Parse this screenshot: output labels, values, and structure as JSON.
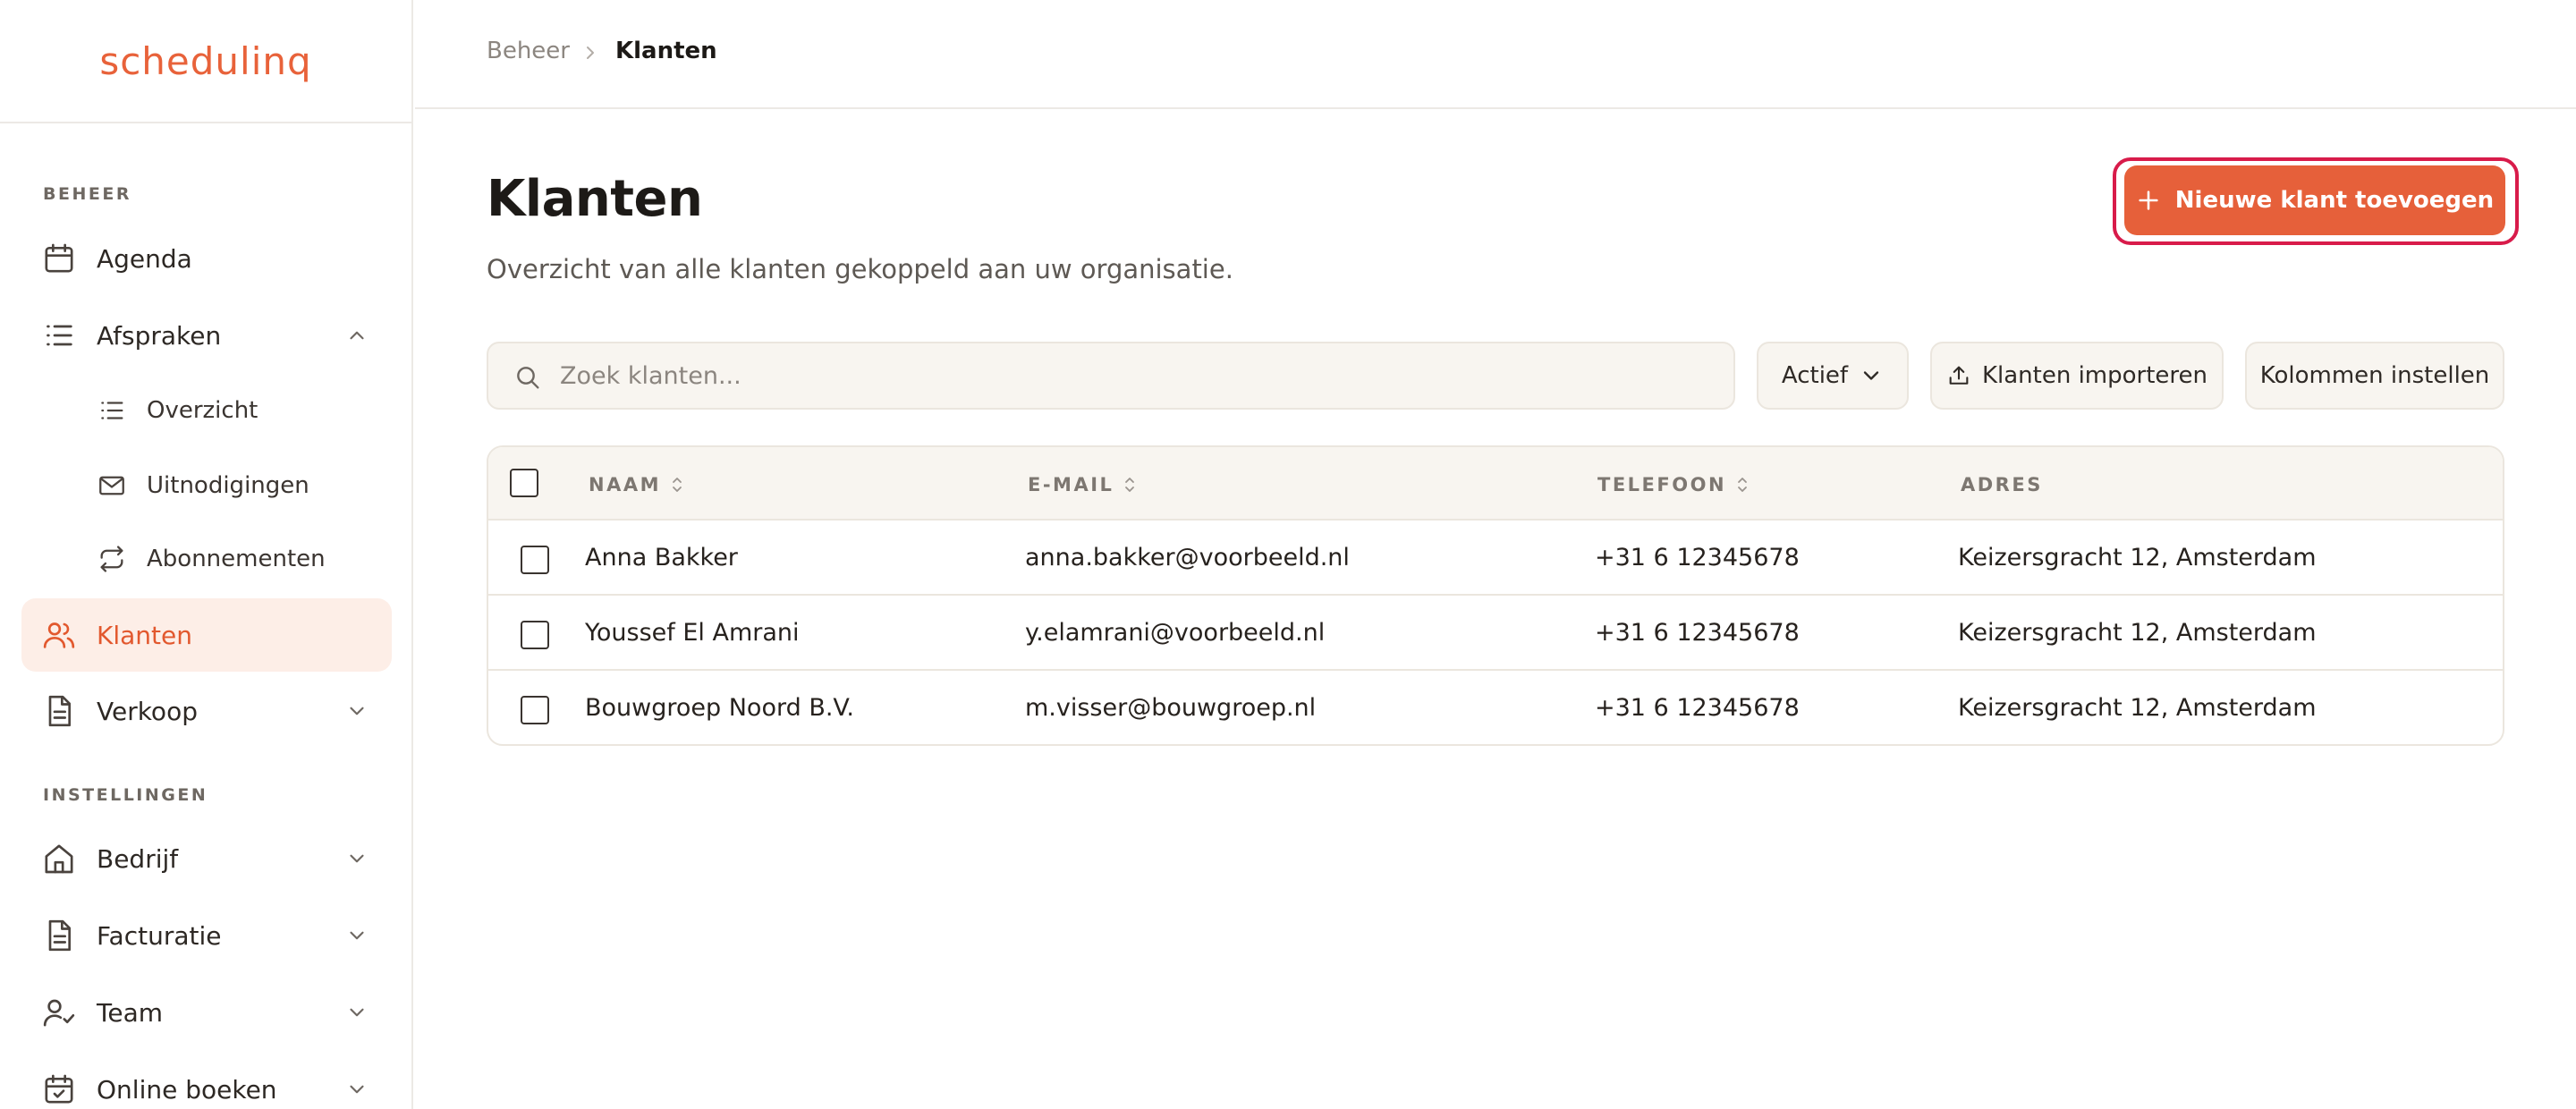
{
  "brand": {
    "logo": "schedulinq",
    "accent": "#e6603a",
    "active_bg": "#fdeee7",
    "focus_ring": "#d81b4a"
  },
  "sidebar": {
    "section_beheer": "BEHEER",
    "section_instellingen": "INSTELLINGEN",
    "items": [
      {
        "label": "Agenda",
        "icon": "calendar-icon"
      },
      {
        "label": "Afspraken",
        "icon": "list-icon",
        "expanded": true
      },
      {
        "label": "Overzicht",
        "icon": "list-icon",
        "sub": true
      },
      {
        "label": "Uitnodigingen",
        "icon": "mail-icon",
        "sub": true
      },
      {
        "label": "Abonnementen",
        "icon": "repeat-icon",
        "sub": true
      },
      {
        "label": "Klanten",
        "icon": "users-icon",
        "active": true
      },
      {
        "label": "Verkoop",
        "icon": "document-icon",
        "expanded": false
      },
      {
        "label": "Bedrijf",
        "icon": "home-icon",
        "expanded": false
      },
      {
        "label": "Facturatie",
        "icon": "document-icon",
        "expanded": false
      },
      {
        "label": "Team",
        "icon": "user-check-icon",
        "expanded": false
      },
      {
        "label": "Online boeken",
        "icon": "calendar-check-icon",
        "expanded": false
      }
    ]
  },
  "breadcrumb": {
    "root": "Beheer",
    "current": "Klanten"
  },
  "header": {
    "title": "Klanten",
    "subtitle": "Overzicht van alle klanten gekoppeld aan uw organisatie.",
    "add_button": "Nieuwe klant toevoegen"
  },
  "toolbar": {
    "search_placeholder": "Zoek klanten...",
    "status_filter": "Actief",
    "import_button": "Klanten importeren",
    "columns_button": "Kolommen instellen"
  },
  "table": {
    "columns": [
      "NAAM",
      "E-MAIL",
      "TELEFOON",
      "ADRES"
    ],
    "rows": [
      {
        "name": "Anna Bakker",
        "email": "anna.bakker@voorbeeld.nl",
        "phone": "+31 6 12345678",
        "address": "Keizersgracht 12, Amsterdam"
      },
      {
        "name": "Youssef El Amrani",
        "email": "y.elamrani@voorbeeld.nl",
        "phone": "+31 6 12345678",
        "address": "Keizersgracht 12, Amsterdam"
      },
      {
        "name": "Bouwgroep Noord B.V.",
        "email": "m.visser@bouwgroep.nl",
        "phone": "+31 6 12345678",
        "address": "Keizersgracht 12, Amsterdam"
      }
    ]
  }
}
